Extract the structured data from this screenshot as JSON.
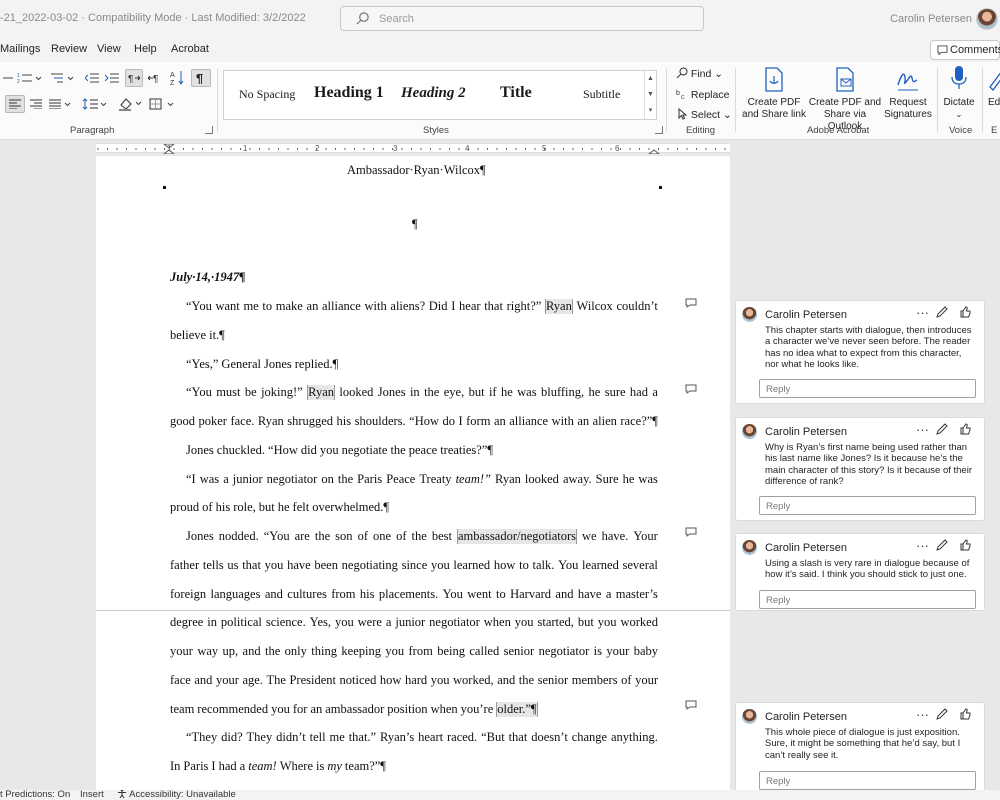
{
  "titlebar": {
    "doc_title": "-21_2022-03-02  ·  Compatibility Mode  ·  Last Modified: 3/2/2022",
    "search_placeholder": "Search",
    "user_name": "Carolin Petersen"
  },
  "tabs": [
    "Mailings",
    "Review",
    "View",
    "Help",
    "Acrobat"
  ],
  "comments_button": "Comments",
  "ribbon": {
    "groups": {
      "paragraph": "Paragraph",
      "styles": "Styles",
      "editing": "Editing",
      "acrobat": "Adobe Acrobat",
      "voice": "Voice",
      "edge": "E"
    },
    "styles": [
      "No Spacing",
      "Heading 1",
      "Heading 2",
      "Title",
      "Subtitle"
    ],
    "editing": {
      "find": "Find",
      "replace": "Replace",
      "select": "Select"
    },
    "acrobat": {
      "create_pdf": [
        "Create PDF",
        "and Share link"
      ],
      "share_outlook": [
        "Create PDF and",
        "Share via Outlook"
      ],
      "request_sig": [
        "Request",
        "Signatures"
      ]
    },
    "dictate": "Dictate",
    "edge_btn": "Ed"
  },
  "ruler_numbers": [
    "1",
    "1",
    "2",
    "3",
    "4",
    "5",
    "6"
  ],
  "document": {
    "header": "Ambassador·Ryan·Wilcox¶",
    "pilcrow": "¶",
    "date": "July·14,·1947¶",
    "lines": [
      {
        "w": [
          "“You",
          "want",
          "me",
          "to",
          "make",
          "an",
          "alliance",
          "with",
          "aliens?",
          "Did",
          "I",
          "hear",
          "that",
          "right?”",
          "Ryan",
          "Wilcox",
          "couldn’t"
        ],
        "hl": [
          14
        ]
      },
      {
        "w": [
          "believe",
          "it.¶"
        ],
        "last": true
      },
      {
        "w": [
          "“Yes,”",
          "General",
          "Jones",
          "replied.¶"
        ],
        "last": true
      },
      {
        "w": [
          "“You",
          "must",
          "be",
          "joking!”",
          "Ryan",
          "looked",
          "Jones",
          "in",
          "the",
          "eye,",
          "but",
          "if",
          "he",
          "was",
          "bluffing,",
          "he",
          "sure",
          "had",
          "a"
        ],
        "hl": [
          4
        ]
      },
      {
        "w": [
          "good",
          "poker",
          "face.",
          "Ryan",
          "shrugged",
          "his",
          "shoulders.",
          "“How",
          "do",
          "I",
          "form",
          "an",
          "alliance",
          "with",
          "an",
          "alien",
          "race?”¶"
        ]
      },
      {
        "w": [
          "Jones",
          "chuckled.",
          "“How",
          "did",
          "you",
          "negotiate",
          "the",
          "peace",
          "treaties?”¶"
        ],
        "last": true
      },
      {
        "w": [
          "“I",
          "was",
          "a",
          "junior",
          "negotiator",
          "on",
          "the",
          "Paris",
          "Peace",
          "Treaty",
          "team!”",
          "Ryan",
          "looked",
          "away.",
          "Sure",
          "he",
          "was"
        ],
        "it": [
          10
        ]
      },
      {
        "w": [
          "proud",
          "of",
          "his",
          "role,",
          "but",
          "he",
          "felt",
          "overwhelmed.¶"
        ],
        "last": true
      },
      {
        "w": [
          "Jones",
          "nodded.",
          "“You",
          "are",
          "the",
          "son",
          "of",
          "one",
          "of",
          "the",
          "best",
          "ambassador/negotiators",
          "we",
          "have.",
          "Your"
        ],
        "hl": [
          11
        ]
      },
      {
        "w": [
          "father",
          "tells",
          "us",
          "that",
          "you",
          "have",
          "been",
          "negotiating",
          "since",
          "you",
          "learned",
          "how",
          "to",
          "talk.",
          "You",
          "learned",
          "several"
        ]
      },
      {
        "w": [
          "foreign",
          "languages",
          "and",
          "cultures",
          "from",
          "his",
          "placements.",
          "You",
          "went",
          "to",
          "Harvard",
          "and",
          "have",
          "a",
          "master’s"
        ]
      },
      {
        "w": [
          "degree",
          "in",
          "political",
          "science.",
          "Yes,",
          "you",
          "were",
          "a",
          "junior",
          "negotiator",
          "when",
          "you",
          "started,",
          "but",
          "you",
          "worked"
        ]
      },
      {
        "w": [
          "your",
          "way",
          "up,",
          "and",
          "the",
          "only",
          "thing",
          "keeping",
          "you",
          "from",
          "being",
          "called",
          "senior",
          "negotiator",
          "is",
          "your",
          "baby"
        ]
      },
      {
        "w": [
          "face",
          "and",
          "your",
          "age.",
          "The",
          "President",
          "noticed",
          "how",
          "hard",
          "you",
          "worked,",
          "and",
          "the",
          "senior",
          "members",
          "of",
          "your"
        ]
      },
      {
        "w": [
          "team",
          "recommended",
          "you",
          "for",
          "an",
          "ambassador",
          "position",
          "when",
          "you’re",
          "older.”¶"
        ],
        "hl": [
          9
        ],
        "last": true
      },
      {
        "w": [
          "“They",
          "did?",
          "They",
          "didn’t",
          "tell",
          "me",
          "that.”",
          "Ryan’s",
          "heart",
          "raced.",
          "“But",
          "that",
          "doesn’t",
          "change",
          "anything."
        ]
      },
      {
        "w": [
          "In",
          "Paris",
          "I",
          "had",
          "a",
          "team!",
          "Where",
          "is",
          "my",
          "team?”¶"
        ],
        "it": [
          5,
          8
        ],
        "last": true
      }
    ]
  },
  "comments": [
    {
      "author": "Carolin Petersen",
      "text": "This chapter starts with dialogue, then introduces a character we’ve never seen before. The reader has no idea what to expect from this character, nor what he looks like.",
      "reply": "Reply"
    },
    {
      "author": "Carolin Petersen",
      "text": "Why is Ryan’s first name being used rather than his last name like Jones? Is it because he’s the main character of this story? Is it because of their difference of rank?",
      "reply": "Reply"
    },
    {
      "author": "Carolin Petersen",
      "text": "Using a slash is very rare in dialogue because of how it’s said. I think you should stick to just one.",
      "reply": "Reply"
    },
    {
      "author": "Carolin Petersen",
      "text": "This whole piece of dialogue is just exposition. Sure, it might be something that he’d say, but I can’t really see it.",
      "reply": "Reply"
    }
  ],
  "status": {
    "predictions": "t Predictions: On",
    "insert": "Insert",
    "accessibility": "Accessibility: Unavailable"
  }
}
